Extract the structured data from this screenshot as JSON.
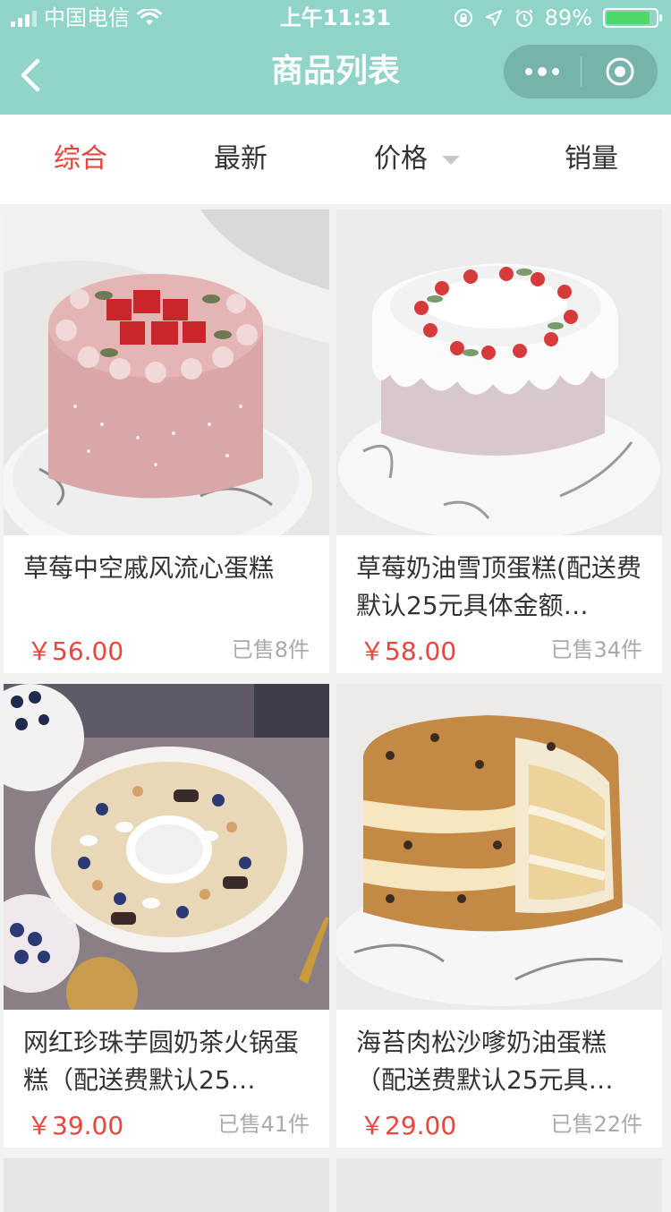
{
  "status_bar": {
    "carrier": "中国电信",
    "time": "上午11:31",
    "battery": "89%",
    "battery_level": 0.89
  },
  "nav": {
    "title": "商品列表"
  },
  "filters": [
    {
      "label": "综合",
      "active": true
    },
    {
      "label": "最新",
      "active": false
    },
    {
      "label": "价格",
      "active": false
    },
    {
      "label": "销量",
      "active": false
    }
  ],
  "products": [
    {
      "title": "草莓中空戚风流心蛋糕",
      "price": "￥56.00",
      "sold": "已售8件",
      "image": "pink-strawberry-cake-image"
    },
    {
      "title": "草莓奶油雪顶蛋糕(配送费默认25元具体金额…",
      "price": "￥58.00",
      "sold": "已售34件",
      "image": "strawberry-cream-cake-image"
    },
    {
      "title": "网红珍珠芋圆奶茶火锅蛋糕（配送费默认25…",
      "price": "￥39.00",
      "sold": "已售41件",
      "image": "bubble-tea-hotpot-cake-image"
    },
    {
      "title": "海苔肉松沙嗲奶油蛋糕（配送费默认25元具…",
      "price": "￥29.00",
      "sold": "已售22件",
      "image": "pork-floss-cake-image"
    }
  ],
  "colors": {
    "header": "#8fd3c9",
    "accent": "#e0463c",
    "price": "#e8463c"
  }
}
